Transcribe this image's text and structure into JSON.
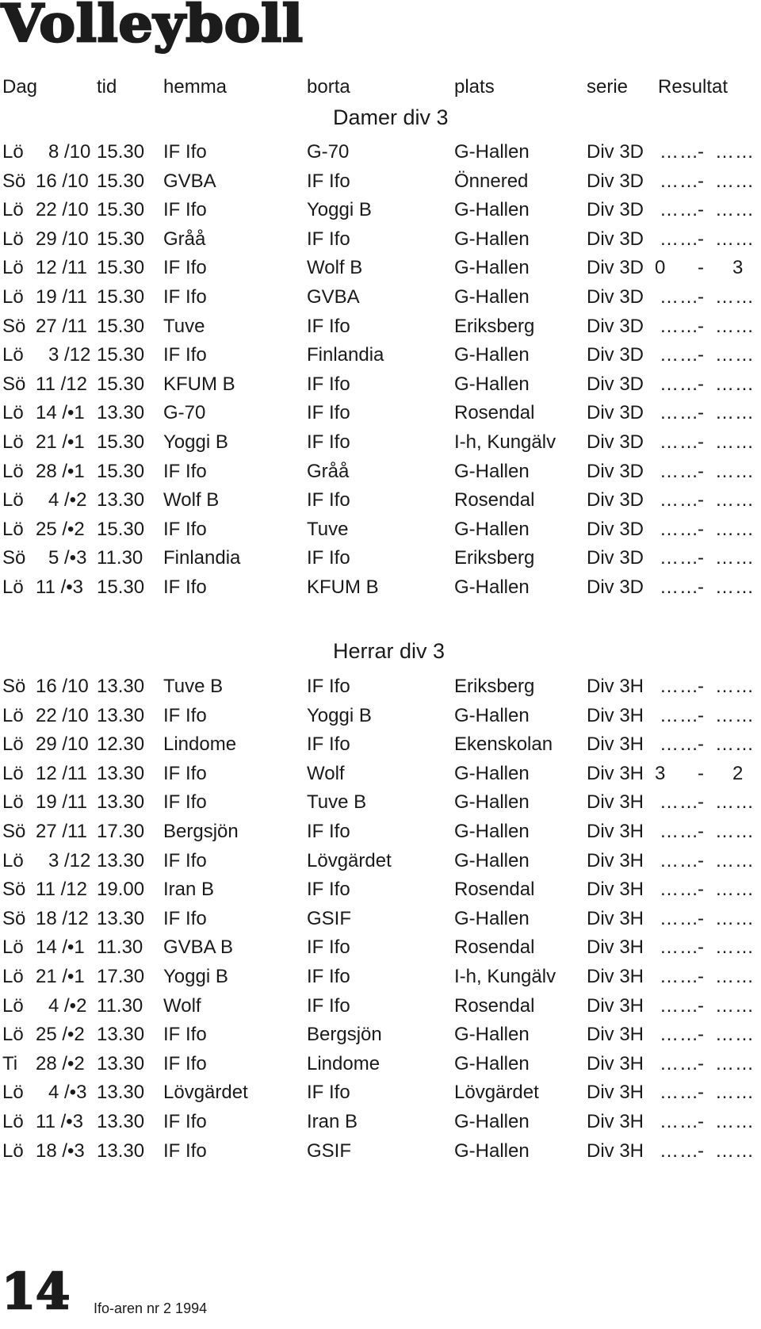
{
  "title": "Volleyboll",
  "columns": {
    "day": "Dag",
    "time": "tid",
    "home": "hemma",
    "away": "borta",
    "venue": "plats",
    "series": "serie",
    "result": "Resultat"
  },
  "sections": [
    {
      "title": "Damer div 3",
      "matches": [
        {
          "day": "Lö",
          "date": "8 /10",
          "time": "15.30",
          "home": "IF Ifo",
          "away": "G-70",
          "venue": "G-Hallen",
          "series": "Div 3D",
          "result_home": "……",
          "result_away": "……"
        },
        {
          "day": "Sö",
          "date": "16 /10",
          "time": "15.30",
          "home": "GVBA",
          "away": "IF Ifo",
          "venue": "Önnered",
          "series": "Div 3D",
          "result_home": "……",
          "result_away": "……"
        },
        {
          "day": "Lö",
          "date": "22 /10",
          "time": "15.30",
          "home": "IF Ifo",
          "away": "Yoggi B",
          "venue": "G-Hallen",
          "series": "Div 3D",
          "result_home": "……",
          "result_away": "……"
        },
        {
          "day": "Lö",
          "date": "29 /10",
          "time": "15.30",
          "home": "Gråå",
          "away": "IF Ifo",
          "venue": "G-Hallen",
          "series": "Div 3D",
          "result_home": "……",
          "result_away": "……"
        },
        {
          "day": "Lö",
          "date": "12 /11",
          "time": "15.30",
          "home": "IF Ifo",
          "away": "Wolf B",
          "venue": "G-Hallen",
          "series": "Div 3D",
          "result_home": "0",
          "result_away": "3"
        },
        {
          "day": "Lö",
          "date": "19 /11",
          "time": "15.30",
          "home": "IF Ifo",
          "away": "GVBA",
          "venue": "G-Hallen",
          "series": "Div 3D",
          "result_home": "……",
          "result_away": "……"
        },
        {
          "day": "Sö",
          "date": "27 /11",
          "time": "15.30",
          "home": "Tuve",
          "away": "IF Ifo",
          "venue": "Eriksberg",
          "series": "Div 3D",
          "result_home": "……",
          "result_away": "……"
        },
        {
          "day": "Lö",
          "date": "3 /12",
          "time": "15.30",
          "home": "IF Ifo",
          "away": "Finlandia",
          "venue": "G-Hallen",
          "series": "Div 3D",
          "result_home": "……",
          "result_away": "……"
        },
        {
          "day": "Sö",
          "date": "11 /12",
          "time": "15.30",
          "home": "KFUM B",
          "away": "IF Ifo",
          "venue": "G-Hallen",
          "series": "Div 3D",
          "result_home": "……",
          "result_away": "……"
        },
        {
          "day": "Lö",
          "date": "14 /•1",
          "time": "13.30",
          "home": "G-70",
          "away": "IF Ifo",
          "venue": "Rosendal",
          "series": "Div 3D",
          "result_home": "……",
          "result_away": "……"
        },
        {
          "day": "Lö",
          "date": "21 /•1",
          "time": "15.30",
          "home": "Yoggi B",
          "away": "IF Ifo",
          "venue": "I-h, Kungälv",
          "series": "Div 3D",
          "result_home": "……",
          "result_away": "……"
        },
        {
          "day": "Lö",
          "date": "28 /•1",
          "time": "15.30",
          "home": "IF Ifo",
          "away": "Gråå",
          "venue": "G-Hallen",
          "series": "Div 3D",
          "result_home": "……",
          "result_away": "……"
        },
        {
          "day": "Lö",
          "date": "4 /•2",
          "time": "13.30",
          "home": "Wolf B",
          "away": "IF Ifo",
          "venue": "Rosendal",
          "series": "Div 3D",
          "result_home": "……",
          "result_away": "……"
        },
        {
          "day": "Lö",
          "date": "25 /•2",
          "time": "15.30",
          "home": "IF Ifo",
          "away": "Tuve",
          "venue": "G-Hallen",
          "series": "Div 3D",
          "result_home": "……",
          "result_away": "……"
        },
        {
          "day": "Sö",
          "date": "5 /•3",
          "time": "11.30",
          "home": "Finlandia",
          "away": "IF Ifo",
          "venue": "Eriksberg",
          "series": "Div 3D",
          "result_home": "……",
          "result_away": "……"
        },
        {
          "day": "Lö",
          "date": "11 /•3",
          "time": "15.30",
          "home": "IF Ifo",
          "away": "KFUM B",
          "venue": "G-Hallen",
          "series": "Div 3D",
          "result_home": "……",
          "result_away": "……"
        }
      ]
    },
    {
      "title": "Herrar div 3",
      "matches": [
        {
          "day": "Sö",
          "date": "16 /10",
          "time": "13.30",
          "home": "Tuve B",
          "away": "IF Ifo",
          "venue": "Eriksberg",
          "series": "Div 3H",
          "result_home": "……",
          "result_away": "……"
        },
        {
          "day": "Lö",
          "date": "22 /10",
          "time": "13.30",
          "home": "IF Ifo",
          "away": "Yoggi B",
          "venue": "G-Hallen",
          "series": "Div 3H",
          "result_home": "……",
          "result_away": "……"
        },
        {
          "day": "Lö",
          "date": "29 /10",
          "time": "12.30",
          "home": "Lindome",
          "away": "IF Ifo",
          "venue": "Ekenskolan",
          "series": "Div 3H",
          "result_home": "……",
          "result_away": "……"
        },
        {
          "day": "Lö",
          "date": "12 /11",
          "time": "13.30",
          "home": "IF Ifo",
          "away": "Wolf",
          "venue": "G-Hallen",
          "series": "Div 3H",
          "result_home": "3",
          "result_away": "2"
        },
        {
          "day": "Lö",
          "date": "19 /11",
          "time": "13.30",
          "home": "IF Ifo",
          "away": "Tuve B",
          "venue": "G-Hallen",
          "series": "Div 3H",
          "result_home": "……",
          "result_away": "……"
        },
        {
          "day": "Sö",
          "date": "27 /11",
          "time": "17.30",
          "home": "Bergsjön",
          "away": "IF Ifo",
          "venue": "G-Hallen",
          "series": "Div 3H",
          "result_home": "……",
          "result_away": "……"
        },
        {
          "day": "Lö",
          "date": "3 /12",
          "time": "13.30",
          "home": "IF Ifo",
          "away": "Lövgärdet",
          "venue": "G-Hallen",
          "series": "Div 3H",
          "result_home": "……",
          "result_away": "……"
        },
        {
          "day": "Sö",
          "date": "11 /12",
          "time": "19.00",
          "home": "Iran B",
          "away": "IF Ifo",
          "venue": "Rosendal",
          "series": "Div 3H",
          "result_home": "……",
          "result_away": "……"
        },
        {
          "day": "Sö",
          "date": "18 /12",
          "time": "13.30",
          "home": "IF Ifo",
          "away": "GSIF",
          "venue": "G-Hallen",
          "series": "Div 3H",
          "result_home": "……",
          "result_away": "……"
        },
        {
          "day": "Lö",
          "date": "14 /•1",
          "time": "11.30",
          "home": "GVBA B",
          "away": "IF Ifo",
          "venue": "Rosendal",
          "series": "Div 3H",
          "result_home": "……",
          "result_away": "……"
        },
        {
          "day": "Lö",
          "date": "21 /•1",
          "time": "17.30",
          "home": "Yoggi B",
          "away": "IF Ifo",
          "venue": "I-h, Kungälv",
          "series": "Div 3H",
          "result_home": "……",
          "result_away": "……"
        },
        {
          "day": "Lö",
          "date": "4 /•2",
          "time": "11.30",
          "home": "Wolf",
          "away": "IF Ifo",
          "venue": "Rosendal",
          "series": "Div 3H",
          "result_home": "……",
          "result_away": "……"
        },
        {
          "day": "Lö",
          "date": "25 /•2",
          "time": "13.30",
          "home": "IF Ifo",
          "away": "Bergsjön",
          "venue": "G-Hallen",
          "series": "Div 3H",
          "result_home": "……",
          "result_away": "……"
        },
        {
          "day": "Ti",
          "date": "28 /•2",
          "time": "13.30",
          "home": "IF Ifo",
          "away": "Lindome",
          "venue": "G-Hallen",
          "series": "Div 3H",
          "result_home": "……",
          "result_away": "……"
        },
        {
          "day": "Lö",
          "date": "4 /•3",
          "time": "13.30",
          "home": "Lövgärdet",
          "away": "IF Ifo",
          "venue": "Lövgärdet",
          "series": "Div 3H",
          "result_home": "……",
          "result_away": "……"
        },
        {
          "day": "Lö",
          "date": "11 /•3",
          "time": "13.30",
          "home": "IF Ifo",
          "away": "Iran B",
          "venue": "G-Hallen",
          "series": "Div 3H",
          "result_home": "……",
          "result_away": "……"
        },
        {
          "day": "Lö",
          "date": "18 /•3",
          "time": "13.30",
          "home": "IF Ifo",
          "away": "GSIF",
          "venue": "G-Hallen",
          "series": "Div 3H",
          "result_home": "……",
          "result_away": "……"
        }
      ]
    }
  ],
  "result_separator": "-",
  "footer": {
    "page_number": "14",
    "publication": "Ifo-aren nr 2 1994"
  }
}
